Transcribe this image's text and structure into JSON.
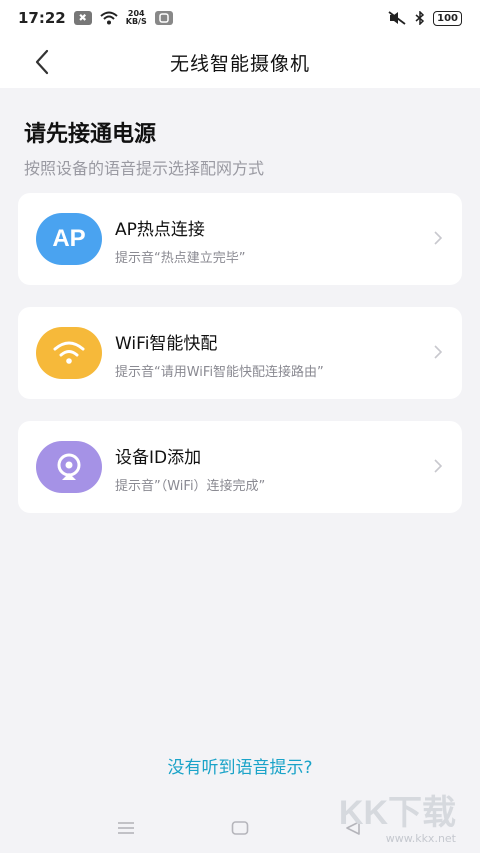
{
  "status_bar": {
    "time": "17:22",
    "badge": "✖",
    "net_speed_value": "204",
    "net_speed_unit": "KB/S",
    "battery": "100"
  },
  "header": {
    "title": "无线智能摄像机"
  },
  "main": {
    "heading": "请先接通电源",
    "subheading": "按照设备的语音提示选择配网方式",
    "options": [
      {
        "icon_text": "AP",
        "title": "AP热点连接",
        "desc": "提示音“热点建立完毕”",
        "icon": "ap-icon",
        "color": "#4aa3f0"
      },
      {
        "title": "WiFi智能快配",
        "desc": "提示音“请用WiFi智能快配连接路由”",
        "icon": "wifi-icon",
        "color": "#f6b93a"
      },
      {
        "title": "设备ID添加",
        "desc": "提示音”（WiFi）连接完成”",
        "icon": "camera-icon",
        "color": "#a592e6"
      }
    ]
  },
  "footer": {
    "help_link": "没有听到语音提示?"
  },
  "watermark": {
    "logo": "KK下载",
    "url": "www.kkx.net"
  }
}
